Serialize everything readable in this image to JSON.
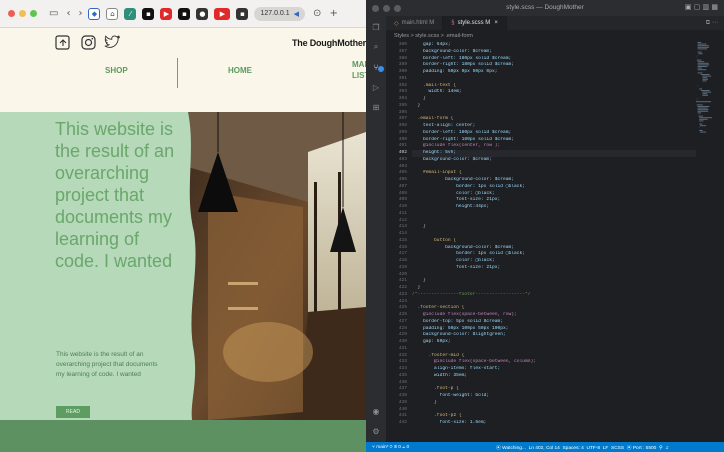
{
  "browser": {
    "address": "127.0.0.1"
  },
  "site": {
    "brand": "The DoughMother",
    "nav": {
      "shop": "SHOP",
      "home": "HOME",
      "mail_line1": "MAI",
      "mail_line2": "LIST"
    },
    "social_icons": [
      "share-icon",
      "instagram-icon",
      "twitter-icon"
    ],
    "hero": {
      "headline": "This website is the result of an overarching project that documents my learning of code. I wanted",
      "body": "This website is the result of an overarching project that documents my learning of code. I wanted",
      "button": "READ"
    },
    "colors": {
      "cream": "#fbf6ea",
      "hero_green": "#b5d9b9",
      "headline_green": "#6aa76b",
      "footer_green": "#5e9162"
    }
  },
  "vscode": {
    "title": "style.scss — DoughMother",
    "tabs": [
      {
        "label": "main.html M",
        "active": false
      },
      {
        "label": "style.scss M",
        "active": true
      }
    ],
    "breadcrumb": "Styles > style.scss > .email-form",
    "code": {
      "lines": [
        {
          "n": "386",
          "t": "    gap: 54px;"
        },
        {
          "n": "387",
          "t": "    background-color: $cream;"
        },
        {
          "n": "388",
          "t": "    border-left: 180px solid $cream;"
        },
        {
          "n": "389",
          "t": "    border-right: 180px solid $cream;"
        },
        {
          "n": "390",
          "t": "    padding: 50px 0px 50px 0px;"
        },
        {
          "n": "391",
          "t": ""
        },
        {
          "n": "392",
          "t": "    .mail-text {"
        },
        {
          "n": "393",
          "t": "      width: 14em;"
        },
        {
          "n": "394",
          "t": "    }"
        },
        {
          "n": "395",
          "t": "  }"
        },
        {
          "n": "396",
          "t": ""
        },
        {
          "n": "397",
          "t": "  .email-form {"
        },
        {
          "n": "398",
          "t": "    text-align: center;"
        },
        {
          "n": "399",
          "t": "    border-left: 180px solid $cream;"
        },
        {
          "n": "400",
          "t": "    border-right: 180px solid $cream;"
        },
        {
          "n": "401",
          "t": "    @include flex(center, row );"
        },
        {
          "n": "402",
          "t": "    height: 5vh;"
        },
        {
          "n": "403",
          "t": "    background-color: $cream;"
        },
        {
          "n": "404",
          "t": ""
        },
        {
          "n": "405",
          "t": "    #email-input {"
        },
        {
          "n": "406",
          "t": "            background-color: $cream;"
        },
        {
          "n": "407",
          "t": "                border: 1px solid ▢black;"
        },
        {
          "n": "408",
          "t": "                color: ▢black;"
        },
        {
          "n": "409",
          "t": "                font-size: 21px;"
        },
        {
          "n": "410",
          "t": "                height:44px;"
        },
        {
          "n": "411",
          "t": ""
        },
        {
          "n": "412",
          "t": ""
        },
        {
          "n": "413",
          "t": "    }"
        },
        {
          "n": "414",
          "t": ""
        },
        {
          "n": "415",
          "t": "        button {"
        },
        {
          "n": "416",
          "t": "            background-color: $cream;"
        },
        {
          "n": "417",
          "t": "                border: 1px solid ▢black;"
        },
        {
          "n": "418",
          "t": "                color: ▢black;"
        },
        {
          "n": "419",
          "t": "                font-size: 21px;"
        },
        {
          "n": "420",
          "t": ""
        },
        {
          "n": "421",
          "t": "    }"
        },
        {
          "n": "422",
          "t": "  }"
        },
        {
          "n": "423",
          "t": "/*---------------footer------------------*/"
        },
        {
          "n": "424",
          "t": ""
        },
        {
          "n": "425",
          "t": "  .footer-section {"
        },
        {
          "n": "426",
          "t": "    @include flex(space-between, row);"
        },
        {
          "n": "427",
          "t": "    border-top: 5px solid $cream;"
        },
        {
          "n": "428",
          "t": "    padding: 50px 100px 50px 100px;"
        },
        {
          "n": "429",
          "t": "    background-color: $lightgreen;"
        },
        {
          "n": "430",
          "t": "    gap: 50px;"
        },
        {
          "n": "431",
          "t": ""
        },
        {
          "n": "432",
          "t": "      .footer-mid {"
        },
        {
          "n": "433",
          "t": "        @include flex(space-between, column);"
        },
        {
          "n": "434",
          "t": "        align-items: flex-start;"
        },
        {
          "n": "435",
          "t": "        width: 35em;"
        },
        {
          "n": "436",
          "t": ""
        },
        {
          "n": "437",
          "t": "        .foot-p {"
        },
        {
          "n": "438",
          "t": "          font-weight: bold;"
        },
        {
          "n": "439",
          "t": "        }"
        },
        {
          "n": "440",
          "t": ""
        },
        {
          "n": "441",
          "t": "        .foot-p2 {"
        },
        {
          "n": "442",
          "t": "          font-size: 1.5em;"
        }
      ],
      "current_line": "402"
    },
    "status": {
      "left": "⑂ main*  ⟳  ⊗ 0 ⚠ 0",
      "right": "⦿ Watching...  Ln 402, Col 14  Spaces: 4  UTF-8  LF  SCSS  ⦿ Port : 5500  ⚲  ♫"
    },
    "colors": {
      "bg": "#1e1f22",
      "status": "#007acc"
    }
  }
}
